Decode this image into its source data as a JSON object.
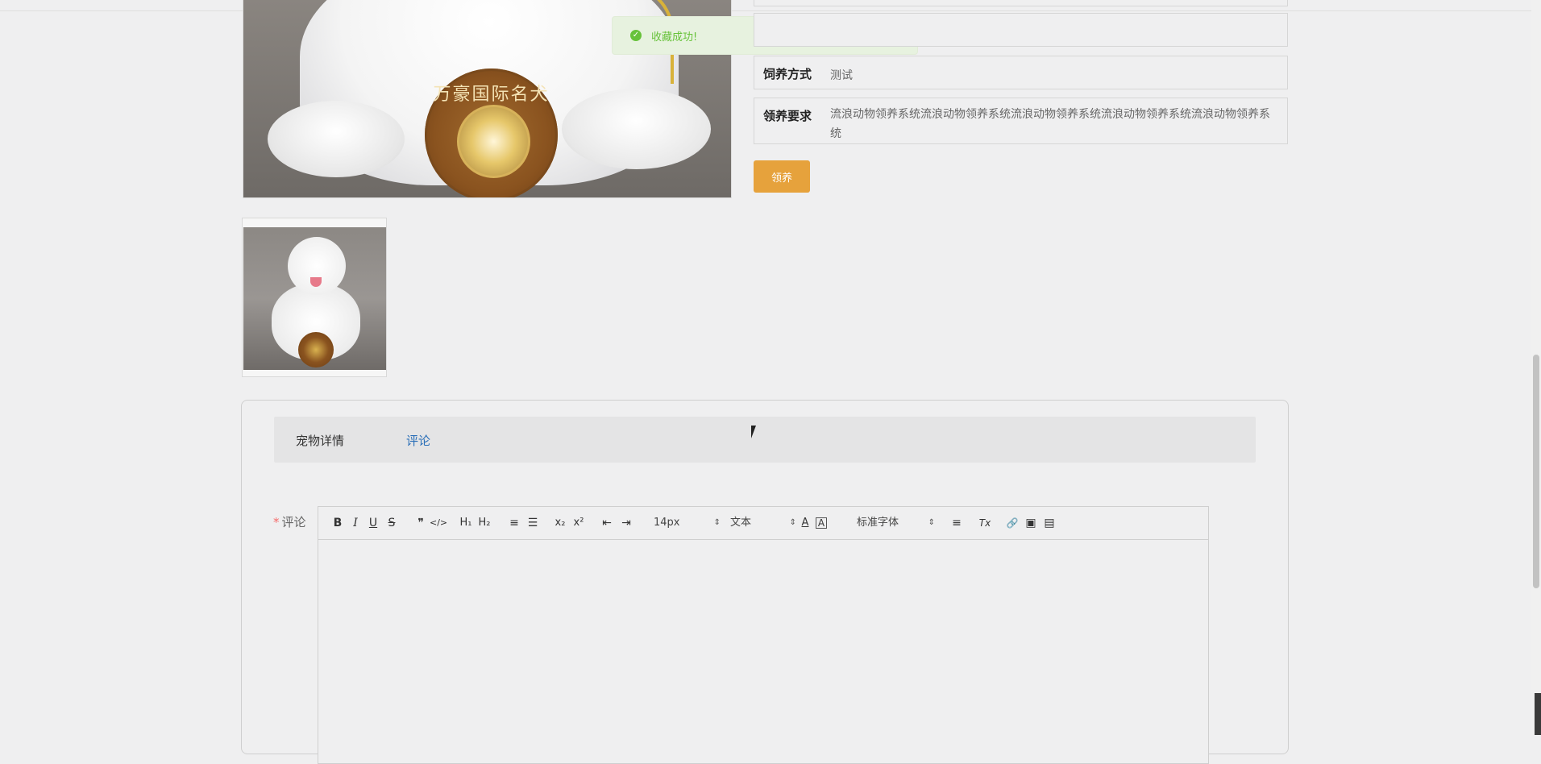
{
  "toast": {
    "message": "收藏成功!"
  },
  "main_image": {
    "medal_text": "万豪国际名犬"
  },
  "info": {
    "feeding_label": "饲养方式",
    "feeding_value": "测试",
    "requirement_label": "领养要求",
    "requirement_value": "流浪动物领养系统流浪动物领养系统流浪动物领养系统流浪动物领养系统流浪动物领养系统"
  },
  "adopt_button": "领养",
  "tabs": [
    {
      "label": "宠物详情",
      "active": false
    },
    {
      "label": "评论",
      "active": true
    }
  ],
  "comment": {
    "label": "评论",
    "required_mark": "*"
  },
  "toolbar": {
    "bold": "B",
    "italic": "I",
    "underline": "U",
    "strike": "S",
    "blockquote": "❞",
    "code": "</>",
    "h1": "H₁",
    "h2": "H₂",
    "ordered_list": "≡",
    "bullet_list": "☰",
    "subscript": "x₂",
    "superscript": "x²",
    "outdent": "⇤",
    "indent": "⇥",
    "size_value": "14px",
    "header_value": "文本",
    "color": "A",
    "background": "A",
    "font_value": "标准字体",
    "align": "≡",
    "clean": "Tx",
    "link": "🔗",
    "image": "▣",
    "video": "▤"
  },
  "colors": {
    "accent_button": "#e6a23c",
    "toast_success": "#67c23a",
    "active_tab": "#2a6fb8",
    "required": "#f56c6c"
  }
}
